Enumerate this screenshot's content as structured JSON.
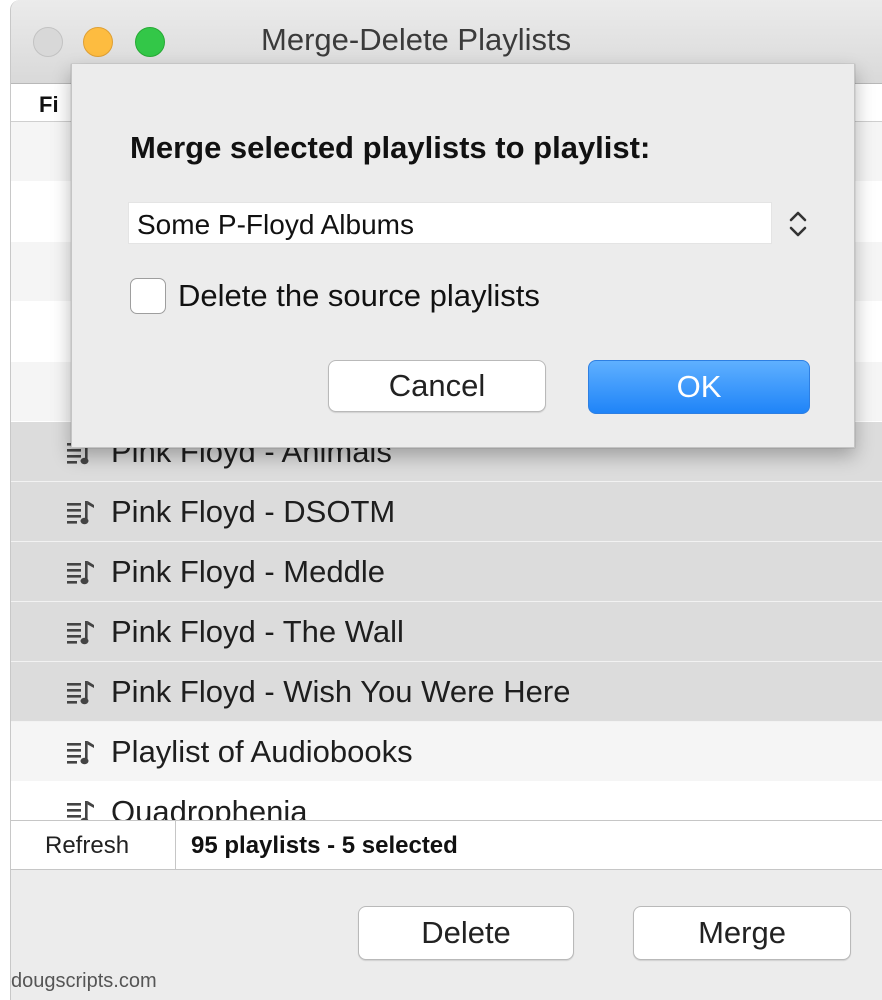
{
  "window": {
    "title": "Merge-Delete Playlists"
  },
  "header": {
    "column_label": "Fi"
  },
  "playlists": [
    {
      "name": "Pink Floyd - Animals",
      "selected": true
    },
    {
      "name": "Pink Floyd - DSOTM",
      "selected": true
    },
    {
      "name": "Pink Floyd - Meddle",
      "selected": true
    },
    {
      "name": "Pink Floyd - The Wall",
      "selected": true
    },
    {
      "name": "Pink Floyd - Wish You Were Here",
      "selected": true
    },
    {
      "name": "Playlist of Audiobooks",
      "selected": false
    },
    {
      "name": "Quadrophenia",
      "selected": false
    }
  ],
  "status": {
    "refresh_label": "Refresh",
    "summary": "95 playlists - 5 selected"
  },
  "actions": {
    "delete_label": "Delete",
    "merge_label": "Merge"
  },
  "footer": {
    "text": "dougscripts.com"
  },
  "dialog": {
    "prompt": "Merge selected playlists to playlist:",
    "target_playlist": "Some P-Floyd Albums",
    "delete_source_label": "Delete the source playlists",
    "delete_source_checked": false,
    "cancel_label": "Cancel",
    "ok_label": "OK"
  },
  "icons": {
    "playlist": "playlist-icon",
    "popup_arrows": "chevron-updown-icon"
  },
  "colors": {
    "ok_button": "#1f84f8",
    "selected_row": "#dcdcdc",
    "minimize": "#fdbc40",
    "zoom": "#33c748"
  }
}
